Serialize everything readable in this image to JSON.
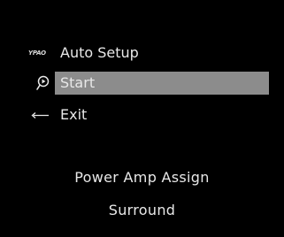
{
  "menu": {
    "title": {
      "logo": "YPAO",
      "label": "Auto Setup"
    },
    "items": [
      {
        "label": "Start",
        "icon": "measure-icon",
        "selected": true
      },
      {
        "label": "Exit",
        "icon": "back-arrow-icon",
        "selected": false
      }
    ]
  },
  "info": {
    "line1": "Power Amp Assign",
    "line2": "Surround"
  },
  "colors": {
    "background": "#000000",
    "text": "#e8e8e8",
    "highlight": "#8c8c8c"
  }
}
